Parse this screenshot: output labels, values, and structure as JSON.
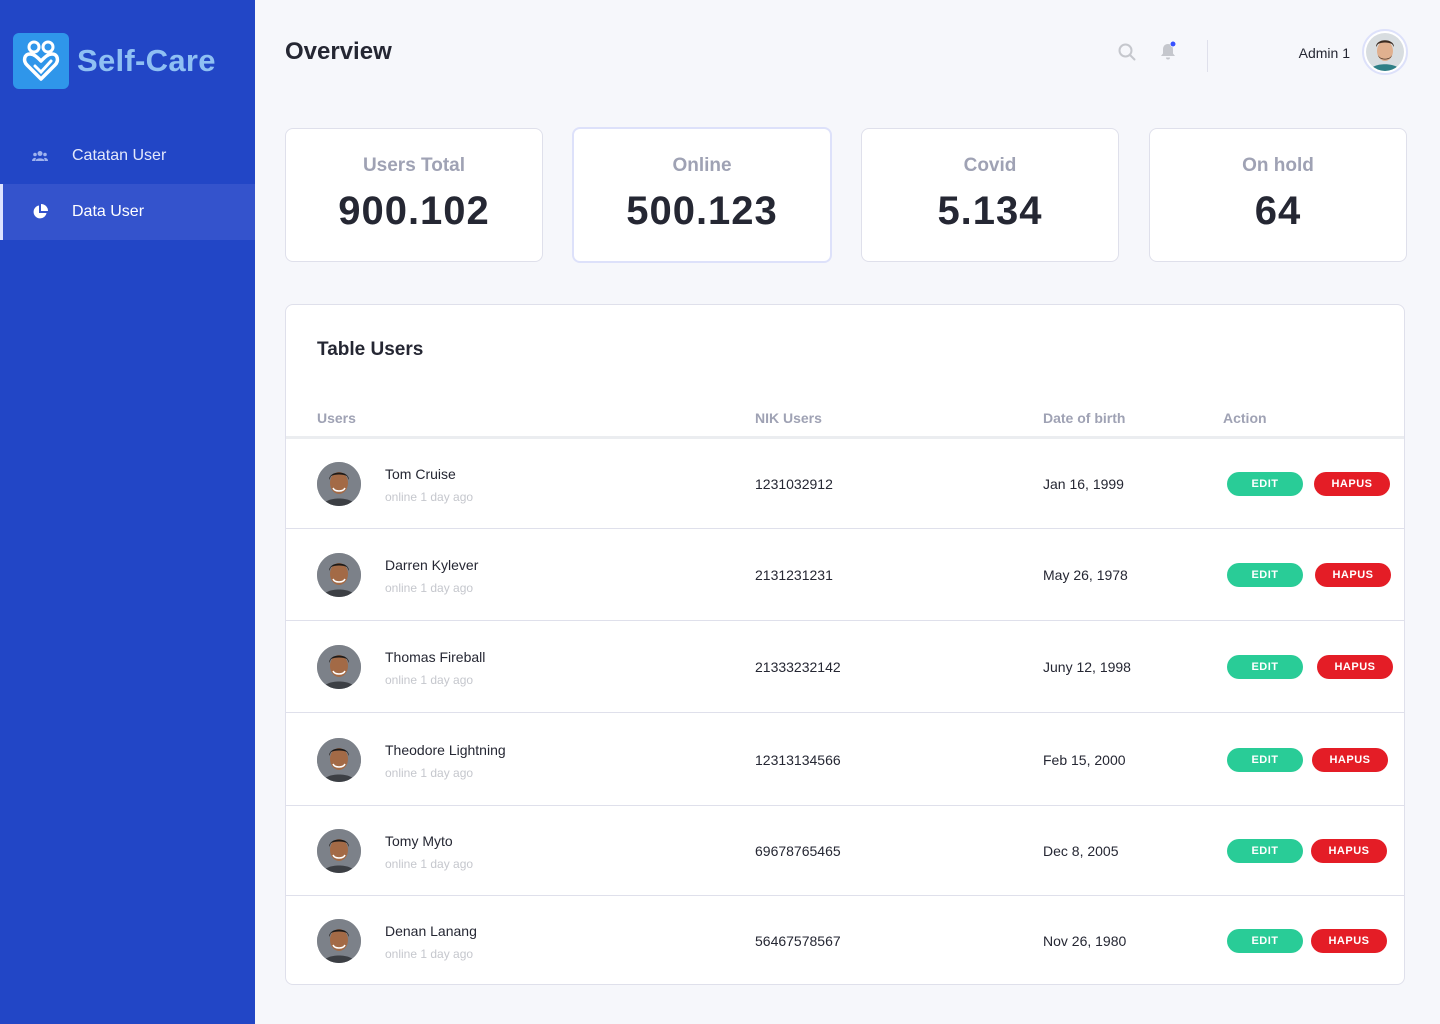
{
  "brand": {
    "name": "Self-Care"
  },
  "sidebar": {
    "items": [
      {
        "label": "Catatan User",
        "icon": "users-icon",
        "active": false
      },
      {
        "label": "Data User",
        "icon": "pie-chart-icon",
        "active": true
      }
    ]
  },
  "header": {
    "title": "Overview",
    "admin_name": "Admin 1"
  },
  "stats": [
    {
      "label": "Users Total",
      "value": "900.102"
    },
    {
      "label": "Online",
      "value": "500.123"
    },
    {
      "label": "Covid",
      "value": "5.134"
    },
    {
      "label": "On hold",
      "value": "64"
    }
  ],
  "table": {
    "title": "Table Users",
    "columns": [
      "Users",
      "NIK Users",
      "Date of birth",
      "Action"
    ],
    "edit_label": "EDIT",
    "delete_label": "HAPUS",
    "rows": [
      {
        "name": "Tom Cruise",
        "status": "online 1 day ago",
        "nik": "1231032912",
        "dob": "Jan 16, 1999"
      },
      {
        "name": "Darren Kylever",
        "status": "online 1 day ago",
        "nik": "2131231231",
        "dob": "May 26, 1978"
      },
      {
        "name": "Thomas Fireball",
        "status": "online 1 day ago",
        "nik": "21333232142",
        "dob": "Juny 12, 1998"
      },
      {
        "name": "Theodore Lightning",
        "status": "online 1 day ago",
        "nik": "12313134566",
        "dob": "Feb 15, 2000"
      },
      {
        "name": "Tomy Myto",
        "status": "online 1 day ago",
        "nik": "69678765465",
        "dob": "Dec 8, 2005"
      },
      {
        "name": "Denan Lanang",
        "status": "online 1 day ago",
        "nik": "56467578567",
        "dob": "Nov 26, 1980"
      }
    ]
  },
  "colors": {
    "sidebar": "#2246c6",
    "edit": "#29cc97",
    "delete": "#e41d26",
    "notification_dot": "#3751ff"
  }
}
